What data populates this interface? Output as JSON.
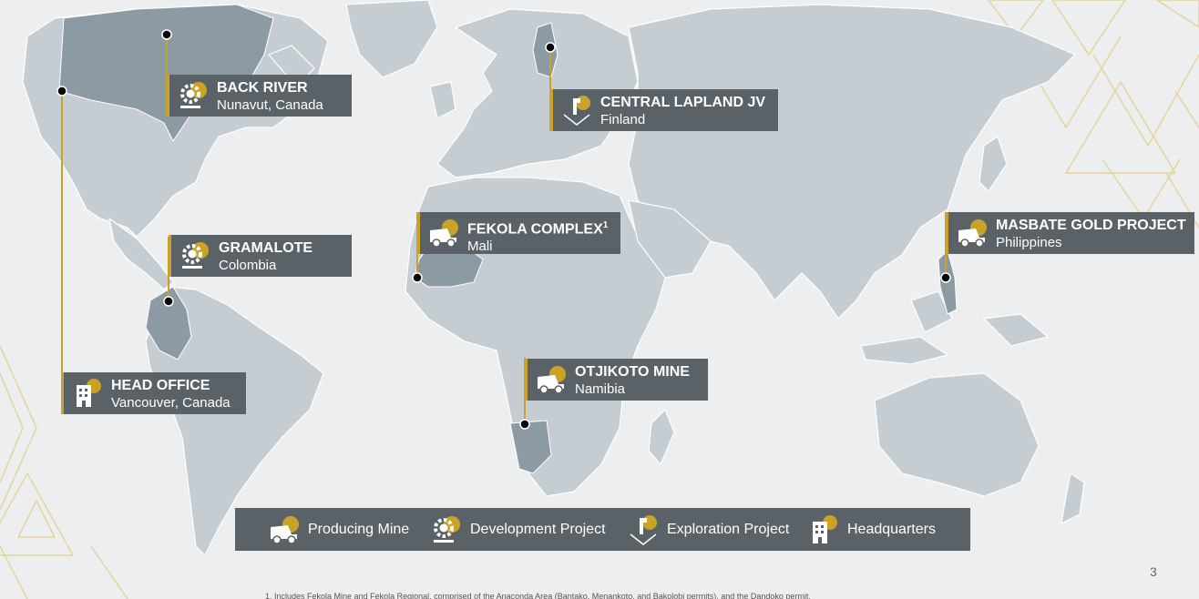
{
  "locations": [
    {
      "id": "back-river",
      "title": "BACK RIVER",
      "subtitle": "Nunavut, Canada",
      "icon": "development-icon"
    },
    {
      "id": "central-lapland",
      "title": "CENTRAL LAPLAND JV",
      "subtitle": "Finland",
      "icon": "exploration-icon"
    },
    {
      "id": "gramalote",
      "title": "GRAMALOTE",
      "subtitle": "Colombia",
      "icon": "development-icon"
    },
    {
      "id": "fekola",
      "title": "FEKOLA COMPLEX",
      "title_sup": "1",
      "subtitle": "Mali",
      "icon": "mining-truck-icon"
    },
    {
      "id": "masbate",
      "title": "MASBATE GOLD PROJECT",
      "subtitle": "Philippines",
      "icon": "mining-truck-icon"
    },
    {
      "id": "otjikoto",
      "title": "OTJIKOTO MINE",
      "subtitle": "Namibia",
      "icon": "mining-truck-icon"
    },
    {
      "id": "head-office",
      "title": "HEAD OFFICE",
      "subtitle": "Vancouver, Canada",
      "icon": "headquarters-icon"
    }
  ],
  "legend": [
    {
      "label": "Producing Mine",
      "icon": "mining-truck-icon"
    },
    {
      "label": "Development Project",
      "icon": "development-icon"
    },
    {
      "label": "Exploration Project",
      "icon": "exploration-icon"
    },
    {
      "label": "Headquarters",
      "icon": "headquarters-icon"
    }
  ],
  "page_number": "3",
  "footnote": "1. Includes Fekola Mine and Fekola Regional, comprised of the Anaconda Area (Bantako, Menankoto, and Bakolobi permits), and the Dandoko permit.",
  "colors": {
    "land": "#c6cdd2",
    "highlight": "#8c9aa4",
    "tag": "#5a6268",
    "gold": "#c9a227",
    "background": "#eceef0"
  }
}
